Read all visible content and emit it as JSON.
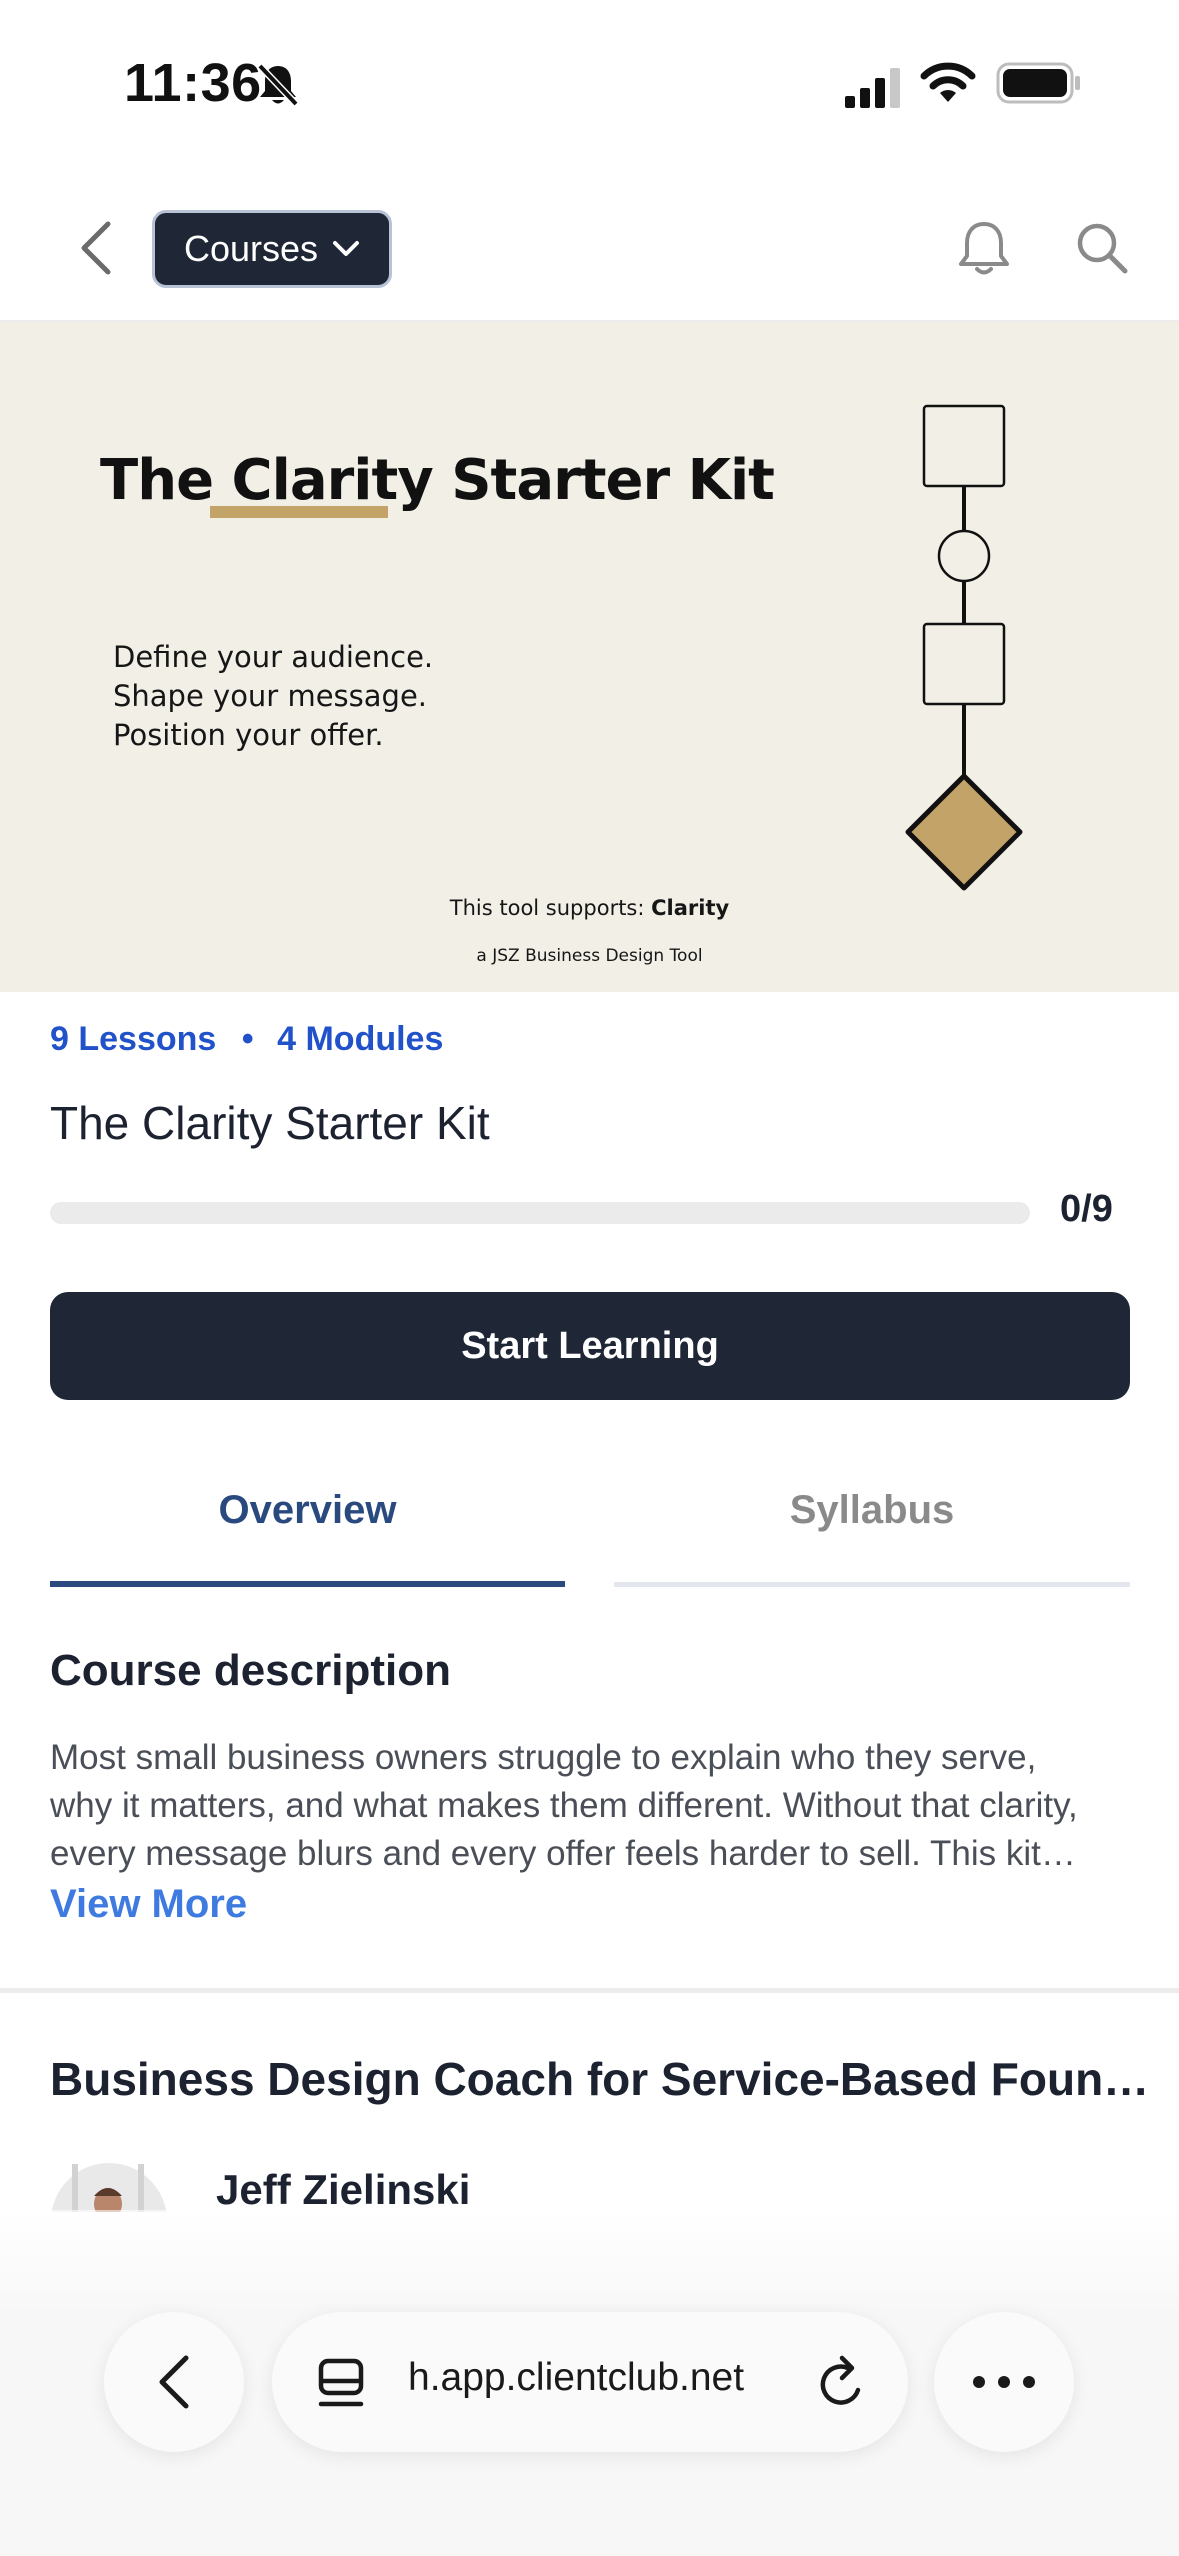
{
  "status_bar": {
    "time": "11:36",
    "icons": [
      "bell-slash-icon",
      "cellular-signal-icon",
      "wifi-icon",
      "battery-icon"
    ]
  },
  "nav": {
    "back_icon": "chevron-left-icon",
    "courses_label": "Courses",
    "dropdown_icon": "chevron-down-icon",
    "notification_icon": "bell-icon",
    "search_icon": "search-icon"
  },
  "hero": {
    "title": "The Clarity Starter Kit",
    "title_parts": {
      "before": "The ",
      "highlight": "Clarity",
      "after": " Starter Kit"
    },
    "lines": [
      "Define your audience.",
      "Shape your message.",
      "Position your offer."
    ],
    "supports_prefix": "This tool supports: ",
    "supports_value": "Clarity",
    "tool_credit": "a JSZ Business Design Tool",
    "accent_color": "#c4a369",
    "background_color": "#f1efe6"
  },
  "course": {
    "lessons": "9 Lessons",
    "separator": "•",
    "modules": "4 Modules",
    "title": "The Clarity Starter Kit",
    "progress_text": "0/9",
    "progress_fraction": 0,
    "start_button": "Start Learning"
  },
  "tabs": {
    "overview": "Overview",
    "syllabus": "Syllabus",
    "active": "Overview"
  },
  "description": {
    "heading": "Course description",
    "lines": [
      "Most small business owners struggle to explain who they serve,",
      "why it matters, and what makes them different. Without that clarity,",
      "every message blurs and every offer feels harder to sell. This kit…"
    ],
    "view_more": "View More"
  },
  "coach": {
    "heading": "Business Design Coach for Service-Based Foun…",
    "name": "Jeff Zielinski"
  },
  "browser": {
    "url": "h.app.clientclub.net",
    "back_icon": "chevron-left-icon",
    "tabs_icon": "tabs-icon",
    "reload_icon": "reload-icon",
    "more_icon": "ellipsis-icon"
  },
  "colors": {
    "dark": "#1f2737",
    "link_blue": "#2152c9",
    "tab_active": "#2a4a7f",
    "view_more": "#3f7ae0"
  }
}
